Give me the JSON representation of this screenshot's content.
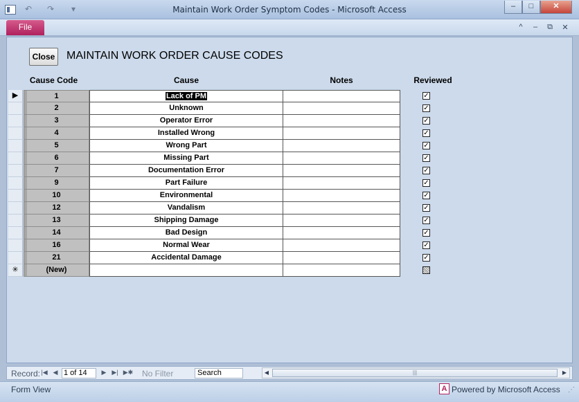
{
  "window": {
    "title": "Maintain Work Order Symptom Codes  -  Microsoft Access",
    "qat_icons": [
      "undo-icon",
      "redo-icon",
      "customize-qat-icon"
    ],
    "controls": {
      "minimize": "–",
      "maximize": "□",
      "close": "✕"
    }
  },
  "ribbon": {
    "file_tab": "File",
    "controls": {
      "collapse": "^",
      "minimize": "–",
      "restore": "⧉",
      "close": "✕"
    }
  },
  "form": {
    "close_label": "Close",
    "title": "MAINTAIN WORK ORDER CAUSE CODES",
    "headers": {
      "code": "Cause Code",
      "cause": "Cause",
      "notes": "Notes",
      "reviewed": "Reviewed"
    },
    "rows": [
      {
        "code": "1",
        "cause": "Lack of PM",
        "notes": "",
        "reviewed": true
      },
      {
        "code": "2",
        "cause": "Unknown",
        "notes": "",
        "reviewed": true
      },
      {
        "code": "3",
        "cause": "Operator Error",
        "notes": "",
        "reviewed": true
      },
      {
        "code": "4",
        "cause": "Installed Wrong",
        "notes": "",
        "reviewed": true
      },
      {
        "code": "5",
        "cause": "Wrong Part",
        "notes": "",
        "reviewed": true
      },
      {
        "code": "6",
        "cause": "Missing Part",
        "notes": "",
        "reviewed": true
      },
      {
        "code": "7",
        "cause": "Documentation Error",
        "notes": "",
        "reviewed": true
      },
      {
        "code": "9",
        "cause": "Part Failure",
        "notes": "",
        "reviewed": true
      },
      {
        "code": "10",
        "cause": "Environmental",
        "notes": "",
        "reviewed": true
      },
      {
        "code": "12",
        "cause": "Vandalism",
        "notes": "",
        "reviewed": true
      },
      {
        "code": "13",
        "cause": "Shipping Damage",
        "notes": "",
        "reviewed": true
      },
      {
        "code": "14",
        "cause": "Bad Design",
        "notes": "",
        "reviewed": true
      },
      {
        "code": "16",
        "cause": "Normal Wear",
        "notes": "",
        "reviewed": true
      },
      {
        "code": "21",
        "cause": "Accidental Damage",
        "notes": "",
        "reviewed": true
      }
    ],
    "new_row_label": "(New)",
    "selector_current": "▶",
    "selector_new": "✳",
    "check_mark": "✓"
  },
  "navigation": {
    "record_label": "Record:",
    "position": "1 of 14",
    "first": "|◀",
    "prev": "◀",
    "next": "▶",
    "last": "▶|",
    "new": "▶✱",
    "no_filter": "No Filter",
    "search": "Search",
    "scroll_left": "◀",
    "scroll_right": "▶",
    "scroll_grip": "|||"
  },
  "status": {
    "view": "Form View",
    "powered_by": "Powered by Microsoft Access",
    "logo_letter": "A"
  },
  "colors": {
    "accent": "#b0205d",
    "form_bg": "#ccdaeb"
  }
}
